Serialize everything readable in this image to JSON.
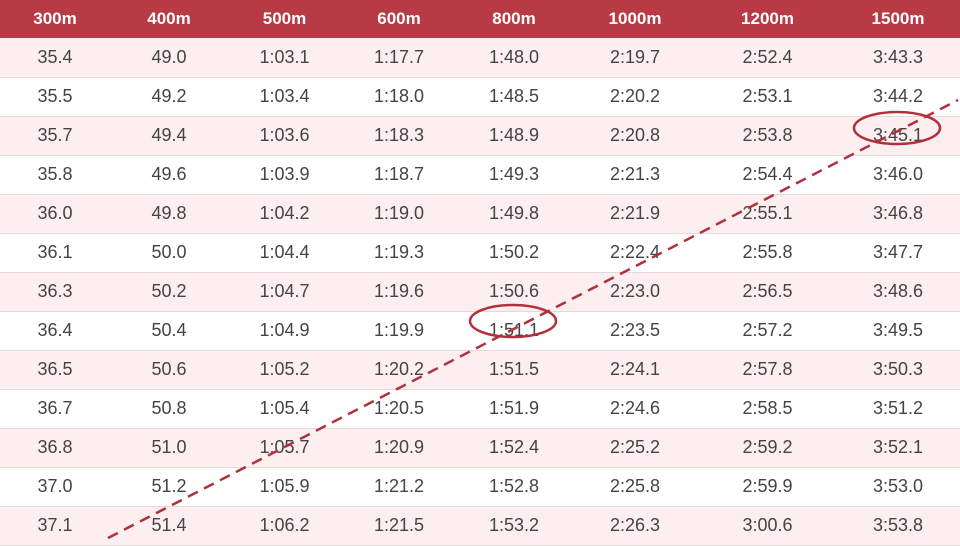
{
  "table": {
    "headers": [
      "300m",
      "400m",
      "500m",
      "600m",
      "800m",
      "1000m",
      "1200m",
      "1500m"
    ],
    "rows": [
      [
        "35.4",
        "49.0",
        "1:03.1",
        "1:17.7",
        "1:48.0",
        "2:19.7",
        "2:52.4",
        "3:43.3"
      ],
      [
        "35.5",
        "49.2",
        "1:03.4",
        "1:18.0",
        "1:48.5",
        "2:20.2",
        "2:53.1",
        "3:44.2"
      ],
      [
        "35.7",
        "49.4",
        "1:03.6",
        "1:18.3",
        "1:48.9",
        "2:20.8",
        "2:53.8",
        "3:45.1"
      ],
      [
        "35.8",
        "49.6",
        "1:03.9",
        "1:18.7",
        "1:49.3",
        "2:21.3",
        "2:54.4",
        "3:46.0"
      ],
      [
        "36.0",
        "49.8",
        "1:04.2",
        "1:19.0",
        "1:49.8",
        "2:21.9",
        "2:55.1",
        "3:46.8"
      ],
      [
        "36.1",
        "50.0",
        "1:04.4",
        "1:19.3",
        "1:50.2",
        "2:22.4",
        "2:55.8",
        "3:47.7"
      ],
      [
        "36.3",
        "50.2",
        "1:04.7",
        "1:19.6",
        "1:50.6",
        "2:23.0",
        "2:56.5",
        "3:48.6"
      ],
      [
        "36.4",
        "50.4",
        "1:04.9",
        "1:19.9",
        "1:51.1",
        "2:23.5",
        "2:57.2",
        "3:49.5"
      ],
      [
        "36.5",
        "50.6",
        "1:05.2",
        "1:20.2",
        "1:51.5",
        "2:24.1",
        "2:57.8",
        "3:50.3"
      ],
      [
        "36.7",
        "50.8",
        "1:05.4",
        "1:20.5",
        "1:51.9",
        "2:24.6",
        "2:58.5",
        "3:51.2"
      ],
      [
        "36.8",
        "51.0",
        "1:05.7",
        "1:20.9",
        "1:52.4",
        "2:25.2",
        "2:59.2",
        "3:52.1"
      ],
      [
        "37.0",
        "51.2",
        "1:05.9",
        "1:21.2",
        "1:52.8",
        "2:25.8",
        "2:59.9",
        "3:53.0"
      ],
      [
        "37.1",
        "51.4",
        "1:06.2",
        "1:21.5",
        "1:53.2",
        "2:26.3",
        "3:00.6",
        "3:53.8"
      ]
    ]
  },
  "colors": {
    "header_bg": "#b83a44",
    "header_text": "#ffffff",
    "row_tint": "#fdeeef",
    "annotation": "#b0303c"
  },
  "annotations": {
    "circled_values": [
      "1:51.1",
      "3:45.1"
    ],
    "dashed_line": "trend line connecting circled values"
  }
}
